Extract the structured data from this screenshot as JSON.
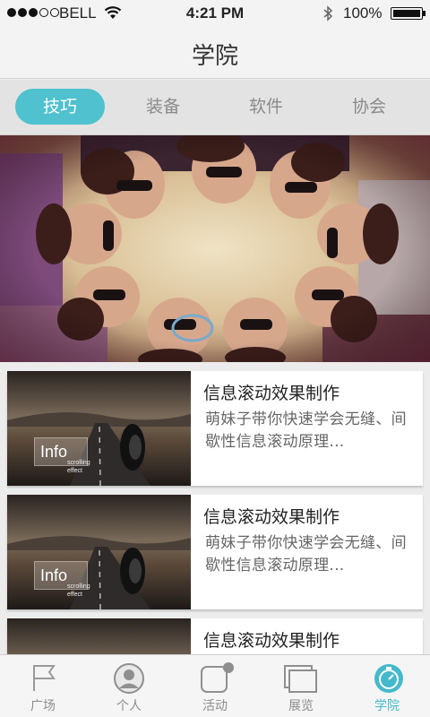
{
  "status_bar": {
    "carrier": "BELL",
    "time": "4:21 PM",
    "battery": "100%"
  },
  "header": {
    "title": "学院"
  },
  "tabs": [
    {
      "label": "技巧",
      "active": true
    },
    {
      "label": "装备",
      "active": false
    },
    {
      "label": "软件",
      "active": false
    },
    {
      "label": "协会",
      "active": false
    }
  ],
  "cards": [
    {
      "title": "信息滚动效果制作",
      "desc": "萌妹子带你快速学会无缝、间歇性信息滚动原理...",
      "thumb_label": "Info",
      "thumb_sub": "scrolling effect"
    },
    {
      "title": "信息滚动效果制作",
      "desc": "萌妹子带你快速学会无缝、间歇性信息滚动原理...",
      "thumb_label": "Info",
      "thumb_sub": "scrolling effect"
    },
    {
      "title": "信息滚动效果制作",
      "desc": "",
      "thumb_label": "",
      "thumb_sub": ""
    }
  ],
  "bottom_nav": [
    {
      "label": "广场",
      "icon": "flag-icon",
      "active": false
    },
    {
      "label": "个人",
      "icon": "person-icon",
      "active": false
    },
    {
      "label": "活动",
      "icon": "activity-icon",
      "active": false
    },
    {
      "label": "展览",
      "icon": "gallery-icon",
      "active": false
    },
    {
      "label": "学院",
      "icon": "academy-icon",
      "active": true
    }
  ],
  "colors": {
    "accent": "#4fc1cf",
    "active_label": "#45b9cb",
    "tab_inactive": "#8a8a8a"
  }
}
